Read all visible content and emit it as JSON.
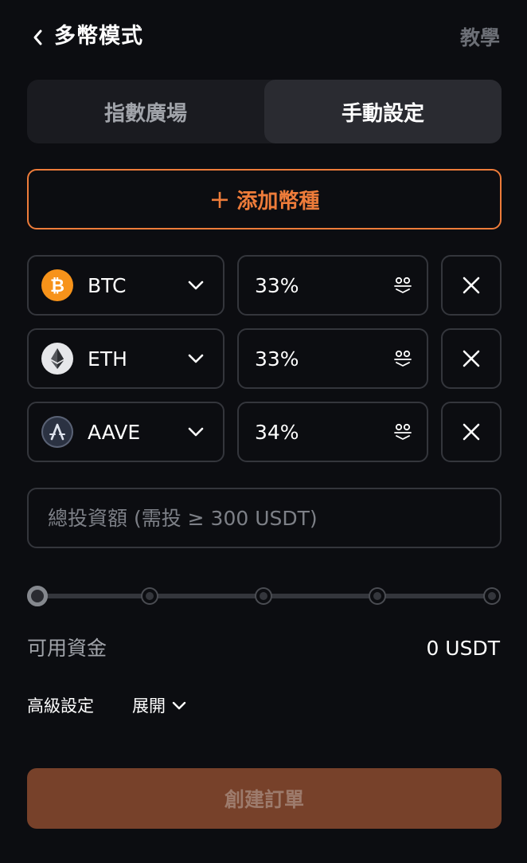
{
  "header": {
    "title": "多幣模式",
    "tutorial_label": "教學"
  },
  "tabs": [
    {
      "label": "指數廣場",
      "active": false
    },
    {
      "label": "手動設定",
      "active": true
    }
  ],
  "add_coin": {
    "plus": "+",
    "label": "添加幣種"
  },
  "coins": [
    {
      "symbol": "BTC",
      "percent": "33%",
      "icon": "bitcoin-logo",
      "color": "#f7931a"
    },
    {
      "symbol": "ETH",
      "percent": "33%",
      "icon": "ethereum-logo",
      "color": "#e6e7ea"
    },
    {
      "symbol": "AAVE",
      "percent": "34%",
      "icon": "aave-logo",
      "color": "#2b3242"
    }
  ],
  "investment": {
    "placeholder": "總投資額 (需投 ≥ 300 USDT)",
    "value": "",
    "slider_percent": 0,
    "slider_steps": [
      0,
      25,
      50,
      75,
      100
    ]
  },
  "available": {
    "label": "可用資金",
    "value": "0 USDT"
  },
  "advanced": {
    "label": "高級設定",
    "toggle_label": "展開"
  },
  "submit": {
    "label": "創建訂單"
  },
  "colors": {
    "accent": "#ee7c3a",
    "background": "#0c0d11",
    "submit_disabled": "#77412a"
  }
}
